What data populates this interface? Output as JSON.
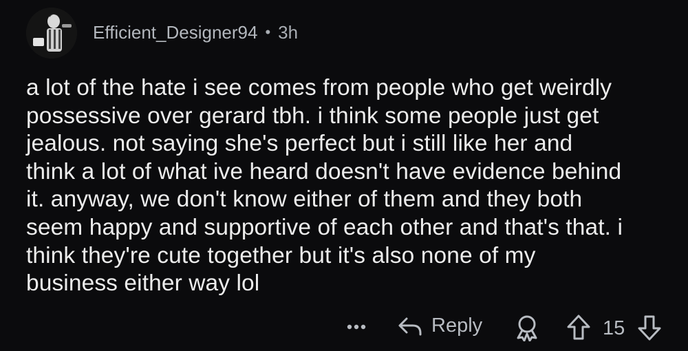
{
  "comment": {
    "username": "Efficient_Designer94",
    "separator": "•",
    "time": "3h",
    "body_lines": [
      "a lot of the hate i see comes from people who get weirdly",
      "possessive over gerard tbh. i think some people just get",
      "jealous. not saying she's perfect but i still like her and",
      "think a lot of what ive heard doesn't have evidence behind",
      "it. anyway, we don't know either of them and they both",
      "seem happy and supportive of each other and that's that. i",
      "think they're cute together but it's also none of my",
      "business either way lol"
    ]
  },
  "actions": {
    "more_icon": "more-horizontal-icon",
    "reply_icon": "reply-arrow-icon",
    "reply_label": "Reply",
    "award_icon": "award-icon",
    "upvote_icon": "upvote-arrow-icon",
    "vote_count": "15",
    "downvote_icon": "downvote-arrow-icon"
  },
  "colors": {
    "background": "#0b0b0d",
    "text": "#ececec",
    "muted": "#a9adb3"
  }
}
